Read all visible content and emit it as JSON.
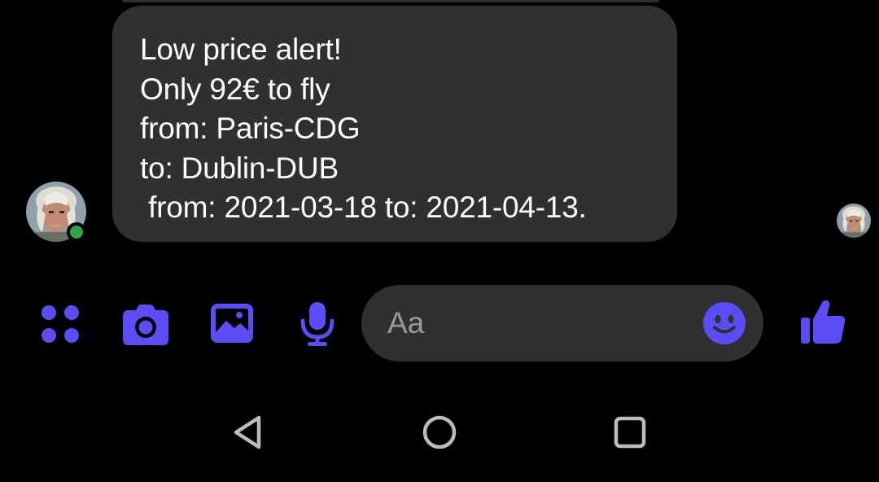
{
  "message": {
    "lines": [
      "Low price alert!",
      "Only 92€ to fly",
      "from: Paris-CDG",
      "to: Dublin-DUB",
      " from: 2021-03-18 to: 2021-04-13."
    ]
  },
  "sender": {
    "online": true,
    "status_color": "#31a24c"
  },
  "composer": {
    "placeholder": "Aa",
    "value": ""
  },
  "toolbar": {
    "icons": [
      "menu-dots-icon",
      "camera-icon",
      "gallery-icon",
      "microphone-icon",
      "emoji-icon",
      "thumbs-up-icon"
    ]
  },
  "navigation": {
    "icons": [
      "back-icon",
      "home-icon",
      "recent-apps-icon"
    ]
  },
  "colors": {
    "accent": "#5b4cf5",
    "background": "#000000",
    "bubble": "#303030",
    "nav_icon": "#bdbdbd",
    "placeholder": "#9a9a9a"
  }
}
